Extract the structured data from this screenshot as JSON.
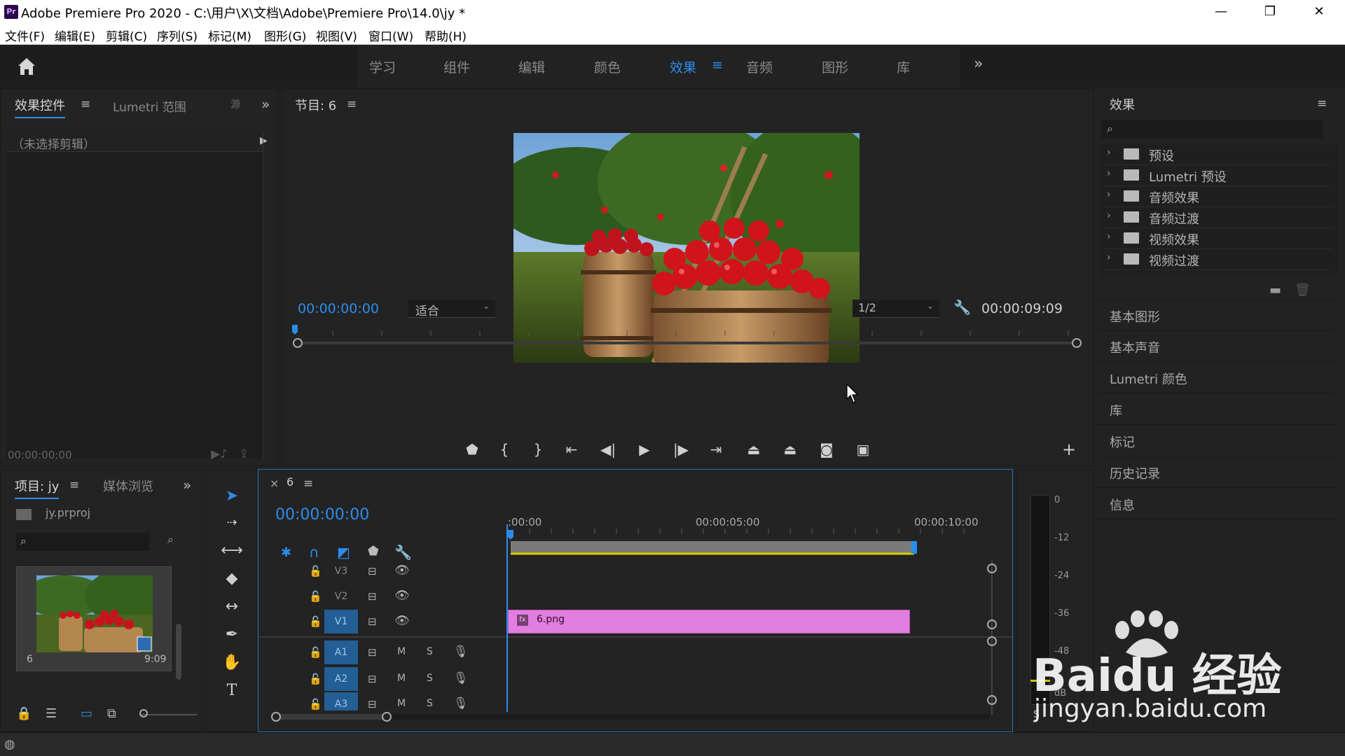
{
  "window": {
    "app_badge": "Pr",
    "title": "Adobe Premiere Pro 2020 - C:\\用户\\X\\文档\\Adobe\\Premiere Pro\\14.0\\jy *",
    "minimize": "—",
    "restore": "❐",
    "close": "✕"
  },
  "menu": {
    "items": [
      "文件(F)",
      "编辑(E)",
      "剪辑(C)",
      "序列(S)",
      "标记(M)",
      "图形(G)",
      "视图(V)",
      "窗口(W)",
      "帮助(H)"
    ]
  },
  "workspace": {
    "tabs": [
      "学习",
      "组件",
      "编辑",
      "颜色",
      "效果",
      "音频",
      "图形",
      "库"
    ],
    "active_tab": "效果",
    "more": "»"
  },
  "effect_controls": {
    "tab_label": "效果控件",
    "tab2_label": "Lumetri 范围",
    "tab3_label": "源",
    "no_clip_text": "（未选择剪辑）",
    "timecode": "00:00:00:00",
    "more": "»"
  },
  "program_monitor": {
    "title": "节目: 6",
    "current_time": "00:00:00:00",
    "fit_option": "适合",
    "resolution": "1/2",
    "duration": "00:00:09:09",
    "add_button": "+"
  },
  "effects_panel": {
    "title": "效果",
    "search_placeholder": "",
    "folders": [
      "预设",
      "Lumetri 预设",
      "音频效果",
      "音频过渡",
      "视频效果",
      "视频过渡"
    ],
    "sections": [
      "基本图形",
      "基本声音",
      "Lumetri 颜色",
      "库",
      "标记",
      "历史记录",
      "信息"
    ]
  },
  "project": {
    "tab_label": "项目: jy",
    "tab2_label": "媒体浏览",
    "file_name": "jy.prproj",
    "item_name": "6",
    "item_duration": "9:09",
    "more": "»"
  },
  "timeline": {
    "close": "×",
    "sequence_name": "6",
    "timecode": "00:00:00:00",
    "ruler_labels": [
      ":00:00",
      "00:00:05:00",
      "00:00:10:00"
    ],
    "video_tracks": [
      "V3",
      "V2",
      "V1"
    ],
    "audio_tracks": [
      "A1",
      "A2",
      "A3"
    ],
    "mute_label": "M",
    "solo_label": "S",
    "clip_name": "6.png",
    "clip_badge": "fx",
    "clip_color": "#e27ee0"
  },
  "meters": {
    "labels": [
      "0",
      "-12",
      "-24",
      "-36",
      "-48",
      "dB"
    ],
    "solo": "S"
  },
  "watermark": {
    "line1": "Baidu 经验",
    "line2": "jingyan.baidu.com"
  },
  "colors": {
    "accent": "#2d8ceb",
    "track_on": "#235e94",
    "clip": "#e27ee0"
  }
}
